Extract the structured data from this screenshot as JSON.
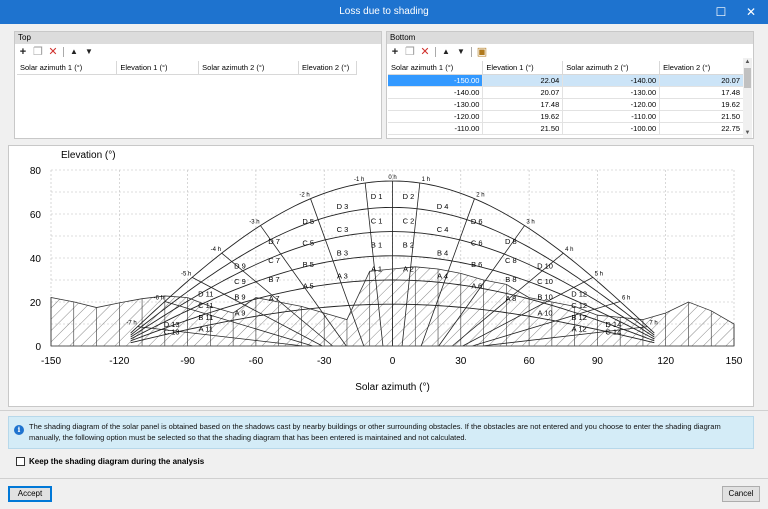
{
  "window": {
    "title": "Loss due to shading"
  },
  "top_panel": {
    "label": "Top",
    "columns": [
      "Solar azimuth 1 (°)",
      "Elevation 1 (°)",
      "Solar azimuth 2 (°)",
      "Elevation 2 (°)"
    ]
  },
  "bottom_panel": {
    "label": "Bottom",
    "columns": [
      "Solar azimuth 1 (°)",
      "Elevation 1 (°)",
      "Solar azimuth 2 (°)",
      "Elevation 2 (°)"
    ],
    "rows": [
      [
        "-150.00",
        "22.04",
        "-140.00",
        "20.07"
      ],
      [
        "-140.00",
        "20.07",
        "-130.00",
        "17.48"
      ],
      [
        "-130.00",
        "17.48",
        "-120.00",
        "19.62"
      ],
      [
        "-120.00",
        "19.62",
        "-110.00",
        "21.50"
      ],
      [
        "-110.00",
        "21.50",
        "-100.00",
        "22.75"
      ]
    ],
    "selected_row": 0
  },
  "chart_data": {
    "type": "area",
    "ylabel": "Elevation (°)",
    "xlabel": "Solar azimuth (°)",
    "xlim": [
      -150,
      150
    ],
    "ylim": [
      0,
      80
    ],
    "xticks": [
      "-150",
      "-120",
      "-90",
      "-60",
      "-30",
      "0",
      "30",
      "60",
      "90",
      "120",
      "150"
    ],
    "yticks": [
      "0",
      "20",
      "40",
      "60",
      "80"
    ],
    "grid": true,
    "horizon_profile": {
      "x": [
        -150,
        -140,
        -130,
        -120,
        -110,
        -100,
        -90,
        -80,
        -70,
        -60,
        -50,
        -40,
        -30,
        -20,
        -10,
        0,
        10,
        20,
        30,
        40,
        50,
        60,
        70,
        80,
        90,
        100,
        110,
        120,
        130,
        140,
        150
      ],
      "y": [
        22.04,
        20.07,
        17.48,
        19.62,
        21.5,
        22.75,
        22,
        18,
        15,
        22,
        20,
        18,
        15,
        12,
        34,
        35,
        36,
        35,
        33,
        30,
        28,
        22,
        20,
        18,
        14,
        13,
        12,
        15,
        20,
        16,
        10
      ]
    },
    "sun_path_labels": [
      "-7 h",
      "-6 h",
      "-5 h",
      "-4 h",
      "-3 h",
      "-2 h",
      "-1 h",
      "0 h",
      "1 h",
      "2 h",
      "3 h",
      "4 h",
      "5 h",
      "6 h",
      "7 h"
    ],
    "zone_labels": [
      "D 1",
      "D 2",
      "D 3",
      "D 4",
      "D 5",
      "D 6",
      "D 7",
      "D 8",
      "D 9",
      "D 10",
      "D 11",
      "D 12",
      "D 13",
      "D 14",
      "C 1",
      "C 2",
      "C 3",
      "C 4",
      "C 5",
      "C 6",
      "C 7",
      "C 8",
      "C 9",
      "C 10",
      "C 11",
      "C 12",
      "C 13",
      "C 14",
      "B 1",
      "B 2",
      "B 3",
      "B 4",
      "B 5",
      "B 6",
      "B 7",
      "B 8",
      "B 9",
      "B 10",
      "B 11",
      "B 12",
      "A 1",
      "A 2",
      "A 3",
      "A 4",
      "A 5",
      "A 6",
      "A 7",
      "A 8",
      "A 9",
      "A 10",
      "A 11",
      "A 12",
      "C 15"
    ]
  },
  "info": {
    "text": "The shading diagram of the solar panel is obtained based on the shadows cast by nearby buildings or other surrounding obstacles. If the obstacles are not entered and you choose to enter the shading diagram manually, the following option must be selected so that the shading diagram that has been entered is maintained and not calculated."
  },
  "option": {
    "label": "Keep the shading diagram during the analysis"
  },
  "buttons": {
    "accept": "Accept",
    "cancel": "Cancel"
  }
}
